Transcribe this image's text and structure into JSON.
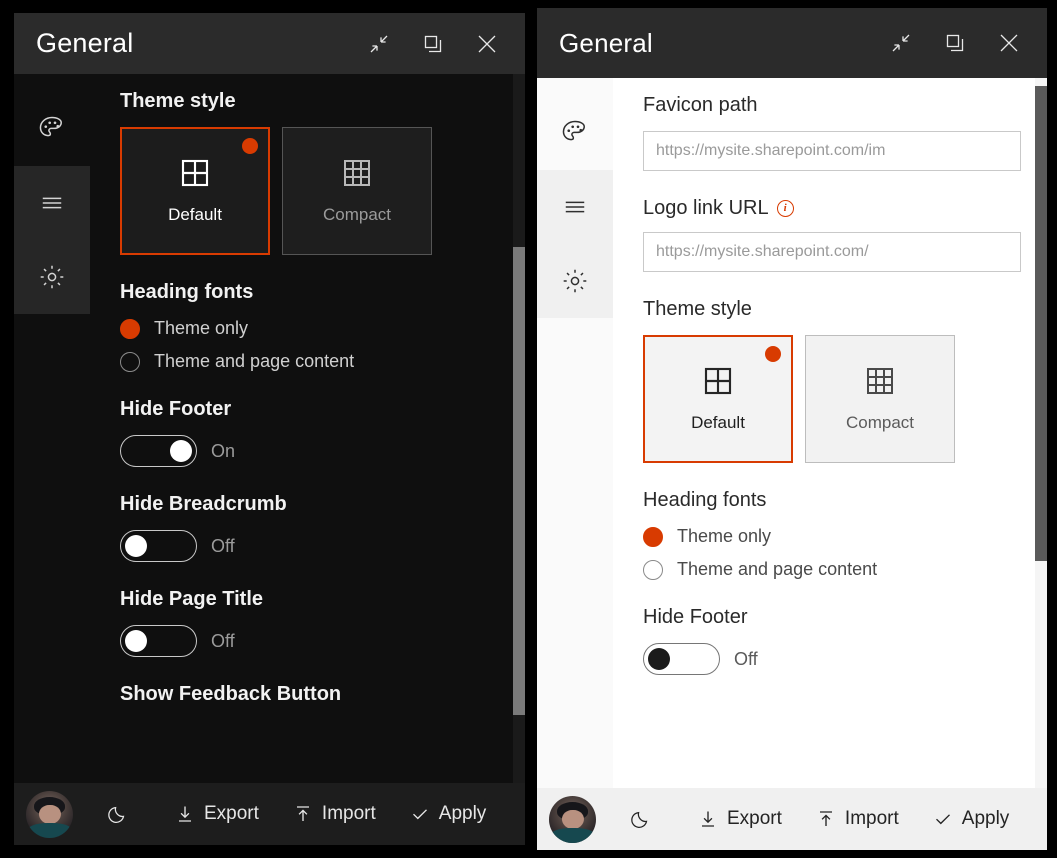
{
  "accent_color": "#D83B01",
  "panels": {
    "dark": {
      "theme": "dark",
      "titlebar": {
        "title": "General",
        "collapse_label": "Collapse",
        "popout_label": "Pop out",
        "close_label": "Close"
      },
      "sidebar": [
        {
          "icon": "palette-icon",
          "label": "Theme"
        },
        {
          "icon": "hamburger-icon",
          "label": "Navigation"
        },
        {
          "icon": "gear-icon",
          "label": "Settings"
        }
      ],
      "sections": {
        "theme_style": {
          "label": "Theme style",
          "cards": [
            {
              "label": "Default",
              "icon": "grid-2x2-icon",
              "selected": true
            },
            {
              "label": "Compact",
              "icon": "grid-3x3-icon",
              "selected": false
            }
          ]
        },
        "heading_fonts": {
          "label": "Heading fonts",
          "options": [
            {
              "label": "Theme only",
              "checked": true
            },
            {
              "label": "Theme and page content",
              "checked": false
            }
          ]
        },
        "toggles": [
          {
            "label": "Hide Footer",
            "state": "On",
            "on": true
          },
          {
            "label": "Hide Breadcrumb",
            "state": "Off",
            "on": false
          },
          {
            "label": "Hide Page Title",
            "state": "Off",
            "on": false
          }
        ],
        "partial_label": "Show Feedback Button"
      },
      "footer": {
        "avatar_label": "User avatar",
        "darkmode_label": "Toggle dark mode",
        "export_label": "Export",
        "import_label": "Import",
        "apply_label": "Apply"
      }
    },
    "light": {
      "theme": "light",
      "titlebar": {
        "title": "General",
        "collapse_label": "Collapse",
        "popout_label": "Pop out",
        "close_label": "Close"
      },
      "sidebar": [
        {
          "icon": "palette-icon",
          "label": "Theme"
        },
        {
          "icon": "hamburger-icon",
          "label": "Navigation"
        },
        {
          "icon": "gear-icon",
          "label": "Settings"
        }
      ],
      "sections": {
        "favicon": {
          "label": "Favicon path",
          "value": "",
          "placeholder": "https://mysite.sharepoint.com/im"
        },
        "logo_link": {
          "label": "Logo link URL",
          "info_icon": "info-icon",
          "info_glyph": "i",
          "value": "",
          "placeholder": "https://mysite.sharepoint.com/"
        },
        "theme_style": {
          "label": "Theme style",
          "cards": [
            {
              "label": "Default",
              "icon": "grid-2x2-icon",
              "selected": true
            },
            {
              "label": "Compact",
              "icon": "grid-3x3-icon",
              "selected": false
            }
          ]
        },
        "heading_fonts": {
          "label": "Heading fonts",
          "options": [
            {
              "label": "Theme only",
              "checked": true
            },
            {
              "label": "Theme and page content",
              "checked": false
            }
          ]
        },
        "toggles": [
          {
            "label": "Hide Footer",
            "state": "Off",
            "on": false
          }
        ]
      },
      "footer": {
        "avatar_label": "User avatar",
        "darkmode_label": "Toggle dark mode",
        "export_label": "Export",
        "import_label": "Import",
        "apply_label": "Apply"
      }
    }
  }
}
